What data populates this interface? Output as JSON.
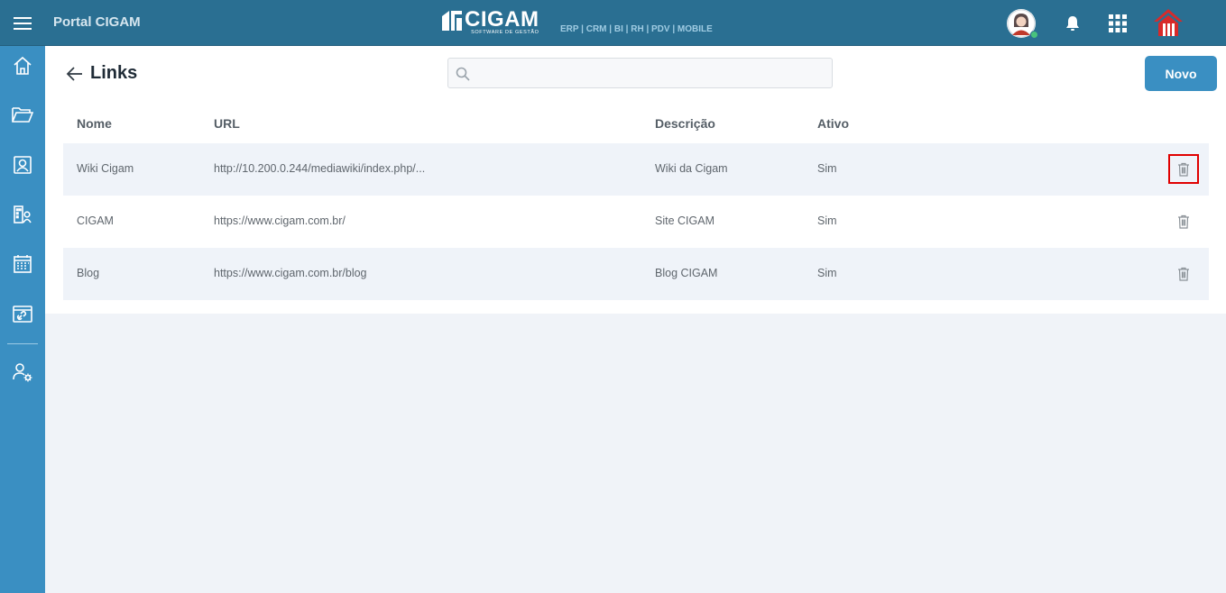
{
  "header": {
    "portal_title": "Portal CIGAM",
    "logo_name": "CIGAM",
    "logo_tagline": "SOFTWARE DE GESTÃO",
    "logo_products": "ERP | CRM | BI | RH | PDV | MOBILE"
  },
  "page": {
    "title": "Links",
    "search_placeholder": "",
    "new_button_label": "Novo"
  },
  "table": {
    "columns": [
      "Nome",
      "URL",
      "Descrição",
      "Ativo"
    ],
    "rows": [
      {
        "nome": "Wiki Cigam",
        "url": "http://10.200.0.244/mediawiki/index.php/...",
        "descricao": "Wiki da Cigam",
        "ativo": "Sim"
      },
      {
        "nome": "CIGAM",
        "url": "https://www.cigam.com.br/",
        "descricao": "Site CIGAM",
        "ativo": "Sim"
      },
      {
        "nome": "Blog",
        "url": "https://www.cigam.com.br/blog",
        "descricao": "Blog CIGAM",
        "ativo": "Sim"
      }
    ]
  },
  "colors": {
    "topbar": "#2a6f92",
    "sidebar": "#3a8fc2",
    "accent_button": "#3a8fc2",
    "highlight_border": "#e00000",
    "status_online": "#48c27d"
  },
  "icons": {
    "menu": "hamburger-icon",
    "sidebar": [
      "home-icon",
      "folder-icon",
      "contact-card-icon",
      "org-people-icon",
      "calendar-icon",
      "link-card-icon",
      "user-settings-icon"
    ],
    "top_right": [
      "user-avatar",
      "bell-icon",
      "apps-grid-icon",
      "home-brand-icon"
    ],
    "row_action": "trash-icon"
  }
}
